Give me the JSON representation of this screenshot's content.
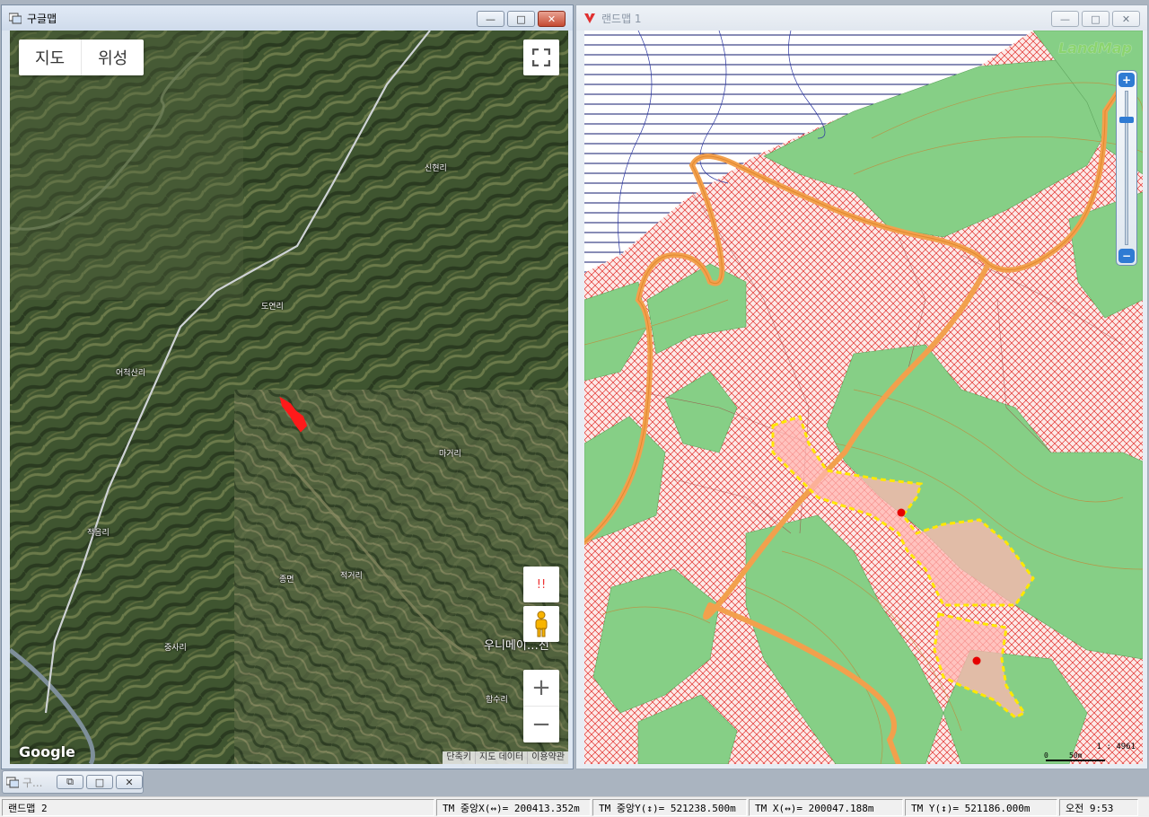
{
  "google_window": {
    "title": "구글맵",
    "buttons": {
      "minimize": "—",
      "maximize": "□",
      "close": "✕"
    },
    "map_type": {
      "map": "지도",
      "satellite": "위성"
    },
    "places": [
      "신현리",
      "도연리",
      "어척산리",
      "마거리",
      "적음리",
      "종면",
      "적거리",
      "중사리",
      "함수리"
    ],
    "cut_label": "우니메이…전",
    "street_view_warning": "!!",
    "zoom_in": "+",
    "zoom_out": "−",
    "logo": "Google",
    "footer": [
      "단축키",
      "지도 데이터",
      "이용약관"
    ],
    "marker_color": "#ff1a1a"
  },
  "landmap_window": {
    "title": "랜드맵 1",
    "buttons": {
      "minimize": "—",
      "maximize": "□",
      "close": "✕"
    },
    "logo": "LandMap",
    "zoom_plus": "+",
    "zoom_minus": "−",
    "zoom_level": 0.17,
    "scale_ratio": "1 : 4961",
    "scale_ticks": [
      "0",
      "50m"
    ],
    "colors": {
      "forest": "#86cf86",
      "hatch": "#e2302c",
      "road": "#f2a04d",
      "highlight": "#ffe800",
      "point": "#e60000"
    }
  },
  "minimized_window": {
    "title": "구...",
    "buttons": [
      "⧉",
      "□",
      "✕"
    ]
  },
  "statusbar": {
    "doc": "랜드맵 2",
    "tm_center_x": "TM 중앙X(↔)= 200413.352m",
    "tm_center_y": "TM 중앙Y(↕)= 521238.500m",
    "tm_x": "TM X(↔)= 200047.188m",
    "tm_y": "TM Y(↕)= 521186.000m",
    "clock": "오전 9:53"
  }
}
